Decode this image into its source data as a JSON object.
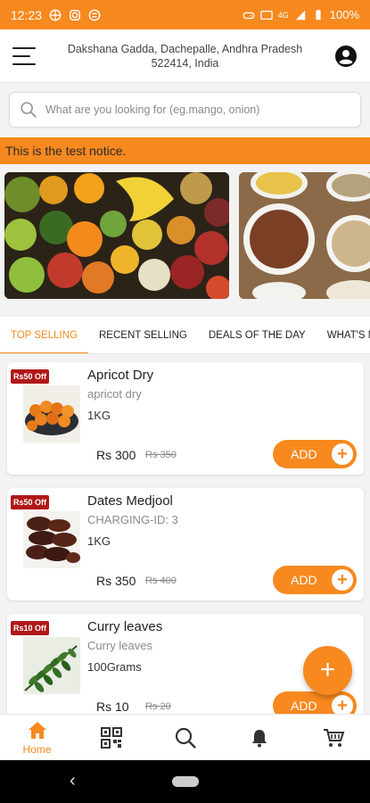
{
  "status_bar": {
    "time": "12:23",
    "battery": "100%",
    "network": "4G"
  },
  "header": {
    "address": "Dakshana Gadda, Dachepalle, Andhra Pradesh 522414, India"
  },
  "search": {
    "placeholder": "What are you looking for (eg.mango, onion)"
  },
  "notice": "This is the test notice.",
  "tabs": [
    "TOP SELLING",
    "RECENT SELLING",
    "DEALS OF THE DAY",
    "WHAT'S N"
  ],
  "products": [
    {
      "badge": "Rs50 Off",
      "name": "Apricot Dry",
      "desc": "apricot dry",
      "qty": "1KG",
      "price": "Rs 300",
      "old_price": "Rs 350",
      "add": "ADD"
    },
    {
      "badge": "Rs50 Off",
      "name": "Dates Medjool",
      "desc": "CHARGING-ID: 3",
      "qty": "1KG",
      "price": "Rs 350",
      "old_price": "Rs 400",
      "add": "ADD"
    },
    {
      "badge": "Rs10 Off",
      "name": "Curry leaves",
      "desc": "Curry leaves",
      "qty": "100Grams",
      "price": "Rs 10",
      "old_price": "Rs 20",
      "add": "ADD"
    }
  ],
  "fab": "+",
  "bottom_nav": {
    "home_label": "Home"
  },
  "colors": {
    "accent": "#f7891f",
    "badge": "#b01818"
  }
}
